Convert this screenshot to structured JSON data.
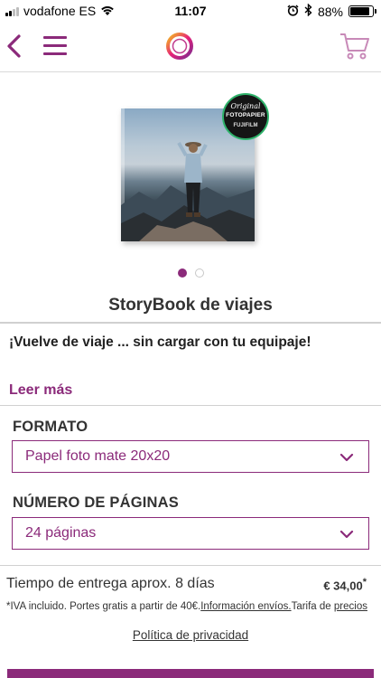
{
  "status_bar": {
    "carrier": "vodafone ES",
    "time": "11:07",
    "battery": "88%",
    "battery_level": 0.88
  },
  "nav": {
    "back_icon": "chevron-left-icon",
    "menu_icon": "hamburger-menu-icon",
    "logo_icon": "brand-ring-logo",
    "cart_icon": "shopping-cart-icon",
    "accent_color": "#8b2a7a"
  },
  "product": {
    "badge_line1": "Original",
    "badge_line2": "FOTOPAPIER",
    "badge_line3": "FUJIFILM",
    "carousel_total": 2,
    "carousel_active": 1,
    "title": "StoryBook de viajes",
    "tagline": "¡Vuelve de viaje ... sin cargar con tu equipaje!",
    "read_more": "Leer más"
  },
  "options": {
    "format_label": "FORMATO",
    "format_value": "Papel foto mate 20x20",
    "pages_label": "NÚMERO DE PÁGINAS",
    "pages_value": "24 páginas"
  },
  "footer": {
    "delivery": "Tiempo de entrega aprox. 8 días",
    "price": "€ 34,00",
    "price_mark": "*",
    "vat_prefix": "*IVA incluido. Portes gratis a partir de 40€.",
    "shipping_link": "Información envíos.",
    "rate_text": "Tarifa de ",
    "prices_link": "precios",
    "privacy": "Política de privacidad"
  }
}
